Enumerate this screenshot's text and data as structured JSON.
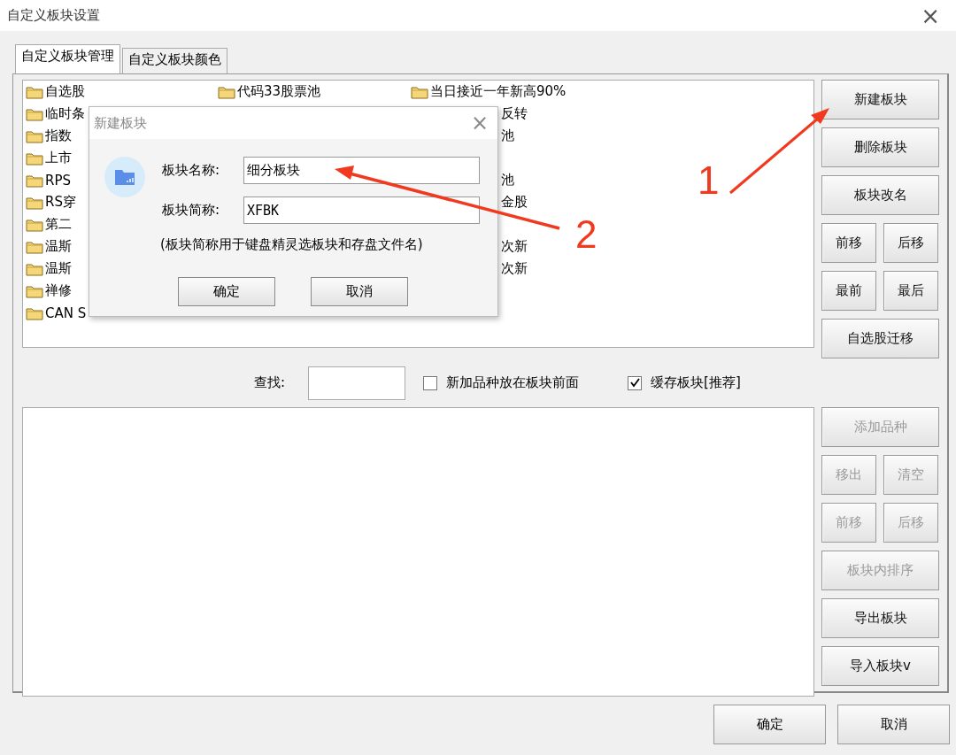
{
  "window": {
    "title": "自定义板块设置",
    "close": "×"
  },
  "tabs": [
    {
      "label": "自定义板块管理",
      "selected": true
    },
    {
      "label": "自定义板块颜色",
      "selected": false
    }
  ],
  "folder_list": {
    "rows": [
      [
        {
          "kind": "full",
          "label": "自选股"
        },
        {
          "kind": "full",
          "label": "代码33股票池"
        },
        {
          "kind": "full",
          "label": "当日接近一年新高90%"
        }
      ],
      [
        {
          "kind": "cut",
          "label": "临时条"
        },
        {
          "kind": "covered"
        },
        {
          "kind": "tail",
          "label": "反转"
        }
      ],
      [
        {
          "kind": "cut",
          "label": "指数"
        },
        {
          "kind": "covered"
        },
        {
          "kind": "tail",
          "label": "池"
        }
      ],
      [
        {
          "kind": "cut",
          "label": "上市"
        },
        {
          "kind": "covered"
        },
        {
          "kind": "covered"
        }
      ],
      [
        {
          "kind": "cut",
          "label": "RPS"
        },
        {
          "kind": "covered"
        },
        {
          "kind": "tail",
          "label": "池"
        }
      ],
      [
        {
          "kind": "cut",
          "label": "RS穿"
        },
        {
          "kind": "covered"
        },
        {
          "kind": "tail",
          "label": "金股"
        }
      ],
      [
        {
          "kind": "cut",
          "label": "第二"
        },
        {
          "kind": "covered"
        },
        {
          "kind": "covered"
        }
      ],
      [
        {
          "kind": "cut",
          "label": "温斯"
        },
        {
          "kind": "covered"
        },
        {
          "kind": "tail",
          "label": "次新"
        }
      ],
      [
        {
          "kind": "cut",
          "label": "温斯"
        },
        {
          "kind": "covered"
        },
        {
          "kind": "tail",
          "label": "次新"
        }
      ],
      [
        {
          "kind": "cut",
          "label": "禅修"
        },
        {
          "kind": "covered"
        },
        {
          "kind": "covered"
        }
      ],
      [
        {
          "kind": "cut",
          "label": "CAN S"
        },
        {
          "kind": "covered"
        },
        {
          "kind": "covered"
        }
      ]
    ]
  },
  "block_buttons": [
    {
      "label": "新建板块",
      "kind": "wide",
      "disabled": false
    },
    {
      "label": "删除板块",
      "kind": "wide",
      "disabled": false
    },
    {
      "label": "板块改名",
      "kind": "wide",
      "disabled": false
    },
    {
      "label": "前移",
      "kind": "half",
      "disabled": false
    },
    {
      "label": "后移",
      "kind": "half",
      "disabled": false
    },
    {
      "label": "最前",
      "kind": "half",
      "disabled": false
    },
    {
      "label": "最后",
      "kind": "half",
      "disabled": false
    },
    {
      "label": "自选股迁移",
      "kind": "wide",
      "disabled": false
    }
  ],
  "search": {
    "label": "查找:"
  },
  "options": [
    {
      "label": "新加品种放在板块前面",
      "checked": false
    },
    {
      "label": "缓存板块[推荐]",
      "checked": true
    }
  ],
  "stock_buttons": [
    {
      "label": "添加品种",
      "kind": "wide",
      "disabled": true
    },
    {
      "label": "移出",
      "kind": "half",
      "disabled": true
    },
    {
      "label": "清空",
      "kind": "half",
      "disabled": true
    },
    {
      "label": "前移",
      "kind": "half",
      "disabled": true
    },
    {
      "label": "后移",
      "kind": "half",
      "disabled": true
    },
    {
      "label": "板块内排序",
      "kind": "wide",
      "disabled": true
    },
    {
      "label": "导出板块",
      "kind": "wide",
      "disabled": false
    },
    {
      "label": "导入板块v",
      "kind": "wide",
      "disabled": false
    }
  ],
  "footer_buttons": [
    "确定",
    "取消"
  ],
  "dialog": {
    "title": "新建板块",
    "close": "×",
    "fields": [
      {
        "label": "板块名称:",
        "value": "细分板块"
      },
      {
        "label": "板块简称:",
        "value": "XFBK"
      }
    ],
    "note": "(板块简称用于键盘精灵选板块和存盘文件名)",
    "buttons": [
      "确定",
      "取消"
    ]
  },
  "annotations": [
    {
      "label": "1"
    },
    {
      "label": "2"
    }
  ]
}
